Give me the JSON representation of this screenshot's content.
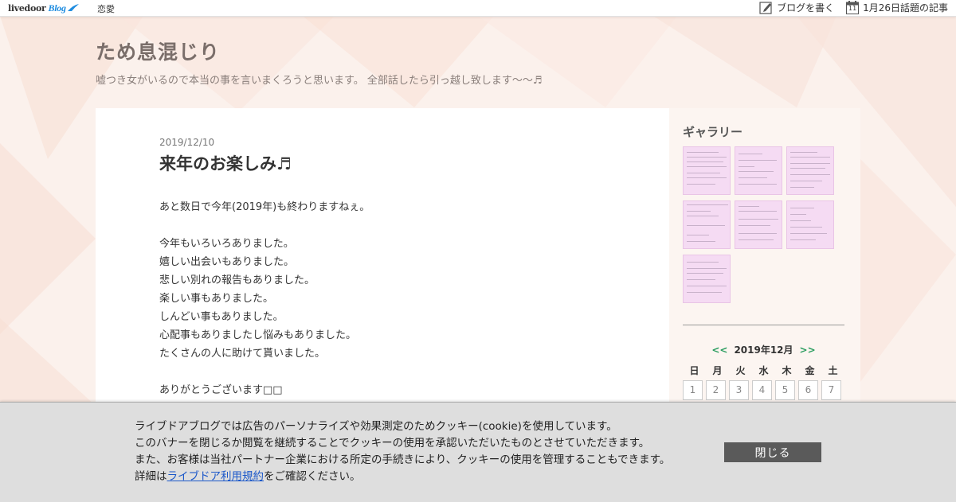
{
  "topbar": {
    "logo_text": "livedoor",
    "logo_blog": "Blog",
    "category": "恋愛",
    "write_blog": "ブログを書く",
    "calendar_day": "11",
    "trending": "1月26日話題の記事"
  },
  "header": {
    "title": "ため息混じり",
    "description": "嘘つき女がいるので本当の事を言いまくろうと思います。 全部話したら引っ越し致します〜〜♬"
  },
  "post": {
    "date": "2019/12/10",
    "title": "来年のお楽しみ♬",
    "lines": [
      "あと数日で今年(2019年)も終わりますねぇ。",
      "",
      "今年もいろいろありました。",
      "嬉しい出会いもありました。",
      "悲しい別れの報告もありました。",
      "楽しい事もありました。",
      "しんどい事もありました。",
      "心配事もありましたし悩みもありました。",
      "たくさんの人に助けて貰いました。",
      "",
      "ありがとうございます□□"
    ]
  },
  "sidebar": {
    "gallery_title": "ギャラリー",
    "calendar": {
      "prev": "<<",
      "month": "2019年12月",
      "next": ">>",
      "weekdays": [
        "日",
        "月",
        "火",
        "水",
        "木",
        "金",
        "土"
      ],
      "days": [
        "1",
        "2",
        "3",
        "4",
        "5",
        "6",
        "7"
      ]
    }
  },
  "cookie": {
    "line1": "ライブドアブログでは広告のパーソナライズや効果測定のためクッキー(cookie)を使用しています。",
    "line2": "このバナーを閉じるか閲覧を継続することでクッキーの使用を承認いただいたものとさせていただきます。",
    "line3": "また、お客様は当社パートナー企業における所定の手続きにより、クッキーの使用を管理することもできます。",
    "line4_prefix": "詳細は",
    "line4_link": "ライブドア利用規約",
    "line4_suffix": "をご確認ください。",
    "close_label": "閉じる"
  },
  "colors": {
    "background": "#fbf1ec",
    "title": "#7a6e6a",
    "link_green": "#2a9d5f",
    "cookie_bg": "#dedede",
    "close_button": "#5a5a5a",
    "gallery_thumb": "#f5dbf3"
  }
}
